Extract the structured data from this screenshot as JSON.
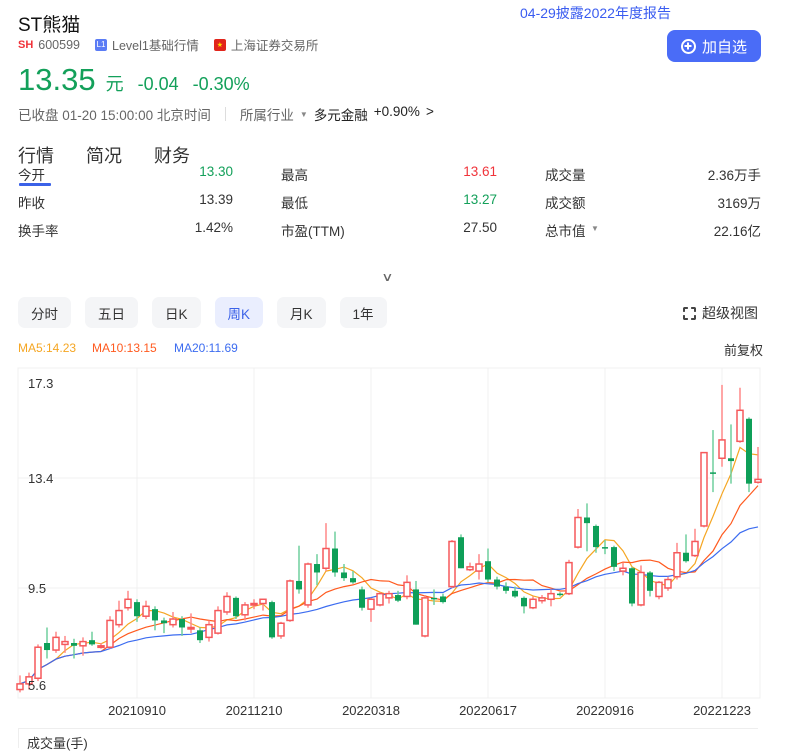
{
  "header": {
    "title": "ST熊猫",
    "report_notice": "04-29披露2022年度报告",
    "add_watch_label": "加自选",
    "market": "SH",
    "code": "600599",
    "level_badge": "L1",
    "level_label": "Level1基础行情",
    "exchange": "上海证券交易所",
    "price": "13.35",
    "unit": "元",
    "change": "-0.04",
    "change_pct": "-0.30%",
    "status": "已收盘 01-20 15:00:00 北京时间",
    "industry_label": "所属行业",
    "industry": "多元金融",
    "industry_change": "+0.90%"
  },
  "tabs": [
    "行情",
    "简况",
    "财务"
  ],
  "active_tab": "行情",
  "stats": [
    {
      "label": "今开",
      "value": "13.30",
      "color": "green"
    },
    {
      "label": "最高",
      "value": "13.61",
      "color": "red"
    },
    {
      "label": "成交量",
      "value": "2.36万手",
      "color": ""
    },
    {
      "label": "昨收",
      "value": "13.39",
      "color": ""
    },
    {
      "label": "最低",
      "value": "13.27",
      "color": "green"
    },
    {
      "label": "成交额",
      "value": "3169万",
      "color": ""
    },
    {
      "label": "换手率",
      "value": "1.42%",
      "color": ""
    },
    {
      "label": "市盈(TTM)",
      "value": "27.50",
      "color": ""
    },
    {
      "label": "总市值",
      "value": "22.16亿",
      "color": ""
    }
  ],
  "periods": [
    "分时",
    "五日",
    "日K",
    "周K",
    "月K",
    "1年"
  ],
  "active_period": "周K",
  "super_view_label": "超级视图",
  "adjust_label": "前复权",
  "ma_legend": {
    "ma5": "MA5:14.23",
    "ma10": "MA10:13.15",
    "ma20": "MA20:11.69"
  },
  "colors": {
    "up": "#f5595b",
    "down": "#0e9f58",
    "ma5": "#f5a623",
    "ma10": "#ff5a1f",
    "ma20": "#3c6cf0",
    "accent": "#4a6cf7"
  },
  "volume_label": "成交量(手)",
  "chart_data": {
    "type": "candlestick",
    "interval": "weekly",
    "y_ticks": [
      "17.3",
      "13.4",
      "9.5",
      "5.6"
    ],
    "ylim": [
      5.6,
      17.3
    ],
    "x_ticks": [
      {
        "label": "20210910",
        "index": 13
      },
      {
        "label": "20211210",
        "index": 26
      },
      {
        "label": "20220318",
        "index": 39
      },
      {
        "label": "20220617",
        "index": 52
      },
      {
        "label": "20220916",
        "index": 65
      },
      {
        "label": "20221223",
        "index": 78
      }
    ],
    "ohlc": [
      [
        5.9,
        6.4,
        5.8,
        6.1
      ],
      [
        6.1,
        6.5,
        5.9,
        6.35
      ],
      [
        6.3,
        7.5,
        6.2,
        7.4
      ],
      [
        7.55,
        8.1,
        7.0,
        7.3
      ],
      [
        7.3,
        7.95,
        7.2,
        7.75
      ],
      [
        7.5,
        7.8,
        7.2,
        7.6
      ],
      [
        7.55,
        7.7,
        7.0,
        7.45
      ],
      [
        7.45,
        7.75,
        7.1,
        7.6
      ],
      [
        7.65,
        7.95,
        7.45,
        7.5
      ],
      [
        7.4,
        7.55,
        7.35,
        7.45
      ],
      [
        7.4,
        8.5,
        7.35,
        8.35
      ],
      [
        8.2,
        9.05,
        8.1,
        8.7
      ],
      [
        8.8,
        9.4,
        8.7,
        9.1
      ],
      [
        9.0,
        9.1,
        8.3,
        8.5
      ],
      [
        8.5,
        9.05,
        8.4,
        8.85
      ],
      [
        8.75,
        8.85,
        8.0,
        8.35
      ],
      [
        8.35,
        8.45,
        7.9,
        8.25
      ],
      [
        8.2,
        8.65,
        8.1,
        8.4
      ],
      [
        8.4,
        8.5,
        7.8,
        8.1
      ],
      [
        8.05,
        8.6,
        7.9,
        8.1
      ],
      [
        8.0,
        8.1,
        7.55,
        7.65
      ],
      [
        7.75,
        8.35,
        7.6,
        8.2
      ],
      [
        7.9,
        8.85,
        7.85,
        8.7
      ],
      [
        8.65,
        9.35,
        8.55,
        9.2
      ],
      [
        9.15,
        9.2,
        8.4,
        8.5
      ],
      [
        8.55,
        9.0,
        8.35,
        8.9
      ],
      [
        8.9,
        9.1,
        8.75,
        8.95
      ],
      [
        8.95,
        9.1,
        8.7,
        9.1
      ],
      [
        9.0,
        9.05,
        7.7,
        7.75
      ],
      [
        7.8,
        8.3,
        7.7,
        8.25
      ],
      [
        8.35,
        9.8,
        8.3,
        9.75
      ],
      [
        9.75,
        11.0,
        9.3,
        9.45
      ],
      [
        8.9,
        10.4,
        8.8,
        10.35
      ],
      [
        10.35,
        10.7,
        9.6,
        10.05
      ],
      [
        10.2,
        11.8,
        10.1,
        10.9
      ],
      [
        10.9,
        11.5,
        9.9,
        10.05
      ],
      [
        10.05,
        10.35,
        9.75,
        9.85
      ],
      [
        9.85,
        10.1,
        9.65,
        9.7
      ],
      [
        9.45,
        9.55,
        8.7,
        8.8
      ],
      [
        8.75,
        9.15,
        8.3,
        9.1
      ],
      [
        8.9,
        9.35,
        8.85,
        9.3
      ],
      [
        9.15,
        9.4,
        8.95,
        9.3
      ],
      [
        9.25,
        9.4,
        9.0,
        9.05
      ],
      [
        9.2,
        9.95,
        9.1,
        9.7
      ],
      [
        9.45,
        9.75,
        8.2,
        8.2
      ],
      [
        7.8,
        9.25,
        7.75,
        9.15
      ],
      [
        9.15,
        9.45,
        8.9,
        9.1
      ],
      [
        9.2,
        9.3,
        8.95,
        9.0
      ],
      [
        9.55,
        11.2,
        9.5,
        11.15
      ],
      [
        11.3,
        11.4,
        10.2,
        10.2
      ],
      [
        10.15,
        10.4,
        10.1,
        10.25
      ],
      [
        10.1,
        10.7,
        9.8,
        10.35
      ],
      [
        10.45,
        10.9,
        9.7,
        9.8
      ],
      [
        9.8,
        9.9,
        9.45,
        9.55
      ],
      [
        9.55,
        9.7,
        9.3,
        9.4
      ],
      [
        9.4,
        9.55,
        9.15,
        9.2
      ],
      [
        9.15,
        9.2,
        8.6,
        8.85
      ],
      [
        8.8,
        9.2,
        8.75,
        9.1
      ],
      [
        9.05,
        9.25,
        8.95,
        9.15
      ],
      [
        9.1,
        9.45,
        8.85,
        9.3
      ],
      [
        9.3,
        9.35,
        9.2,
        9.25
      ],
      [
        9.3,
        10.5,
        9.25,
        10.4
      ],
      [
        10.95,
        12.3,
        10.9,
        12.0
      ],
      [
        12.0,
        12.5,
        10.8,
        11.8
      ],
      [
        11.7,
        11.75,
        10.75,
        10.95
      ],
      [
        10.95,
        11.2,
        10.7,
        10.9
      ],
      [
        10.95,
        11.0,
        10.1,
        10.25
      ],
      [
        10.1,
        10.4,
        9.95,
        10.2
      ],
      [
        10.2,
        10.25,
        8.85,
        8.95
      ],
      [
        8.9,
        10.3,
        8.85,
        10.05
      ],
      [
        10.05,
        10.1,
        9.2,
        9.4
      ],
      [
        9.2,
        9.75,
        9.1,
        9.7
      ],
      [
        9.5,
        9.9,
        9.4,
        9.8
      ],
      [
        9.9,
        11.1,
        9.8,
        10.75
      ],
      [
        10.75,
        11.4,
        10.4,
        10.45
      ],
      [
        10.65,
        11.6,
        10.6,
        11.15
      ],
      [
        11.7,
        14.3,
        11.65,
        14.3
      ],
      [
        13.6,
        15.1,
        12.9,
        13.55
      ],
      [
        14.1,
        16.7,
        13.8,
        14.75
      ],
      [
        14.1,
        15.3,
        13.2,
        14.0
      ],
      [
        14.7,
        16.6,
        14.65,
        15.8
      ],
      [
        15.5,
        15.55,
        12.9,
        13.2
      ],
      [
        13.25,
        14.5,
        13.2,
        13.35
      ]
    ],
    "moving_averages": [
      5,
      10,
      20
    ],
    "grid": true
  }
}
